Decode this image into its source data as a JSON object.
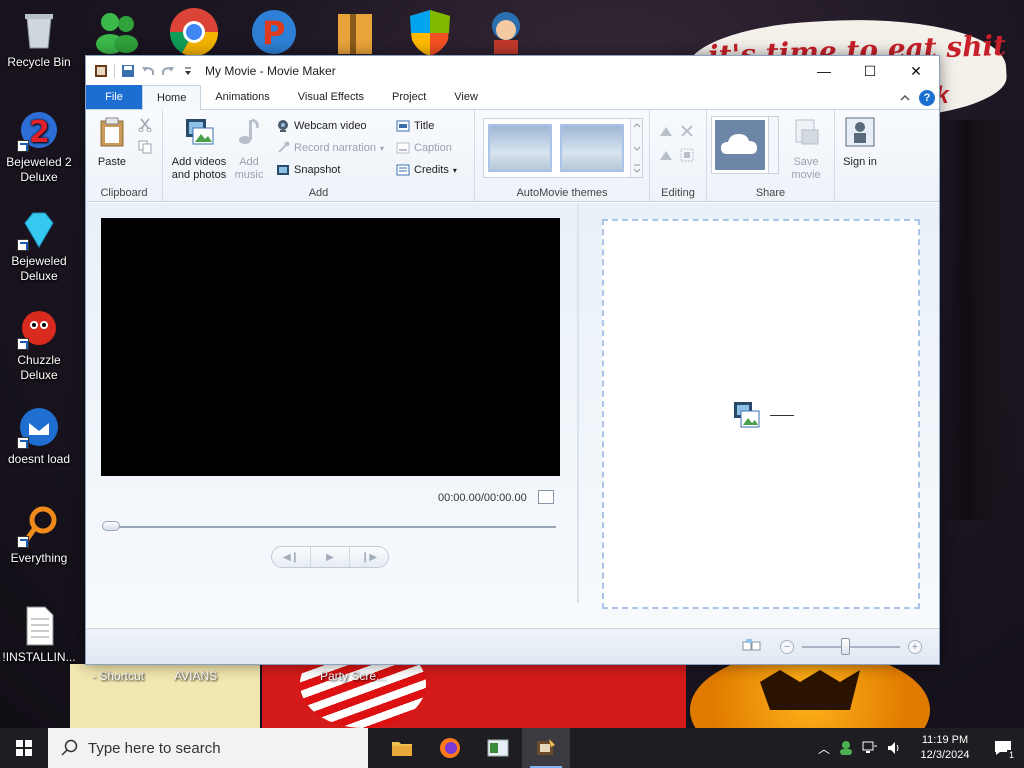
{
  "wallpaper": {
    "cloud_text": "it's time to eat shit",
    "cloud_text_2": "ck",
    "bottom_labels": [
      "- Shortcut",
      "AVIANS",
      "Party Scre..."
    ]
  },
  "desktop_icons": [
    {
      "label": "Recycle Bin"
    },
    {
      "label": "Bejeweled 2 Deluxe"
    },
    {
      "label": "Bejeweled Deluxe"
    },
    {
      "label": "Chuzzle Deluxe"
    },
    {
      "label": "doesnt load"
    },
    {
      "label": "Everything"
    },
    {
      "label": "!INSTALLIN..."
    }
  ],
  "window": {
    "title": "My Movie - Movie Maker",
    "controls": {
      "minimize": "—",
      "maximize": "☐",
      "close": "✕"
    }
  },
  "tabs": [
    {
      "label": "File"
    },
    {
      "label": "Home"
    },
    {
      "label": "Animations"
    },
    {
      "label": "Visual Effects"
    },
    {
      "label": "Project"
    },
    {
      "label": "View"
    }
  ],
  "ribbon": {
    "clipboard": {
      "paste": "Paste",
      "group": "Clipboard"
    },
    "add": {
      "add_videos": "Add videos and photos",
      "add_music": "Add music",
      "webcam": "Webcam video",
      "narration": "Record narration",
      "snapshot": "Snapshot",
      "title": "Title",
      "caption": "Caption",
      "credits": "Credits",
      "group": "Add"
    },
    "themes": {
      "group": "AutoMovie themes"
    },
    "editing": {
      "group": "Editing"
    },
    "share": {
      "save_movie": "Save movie",
      "group": "Share"
    },
    "signin": {
      "label": "Sign in"
    }
  },
  "preview": {
    "timecode": "00:00.00/00:00.00"
  },
  "taskbar": {
    "search_placeholder": "Type here to search",
    "time": "11:19 PM",
    "date": "12/3/2024",
    "notif_count": "1"
  },
  "colors": {
    "accent": "#1c6fd0",
    "storyboard_border": "#a9c4e6"
  }
}
